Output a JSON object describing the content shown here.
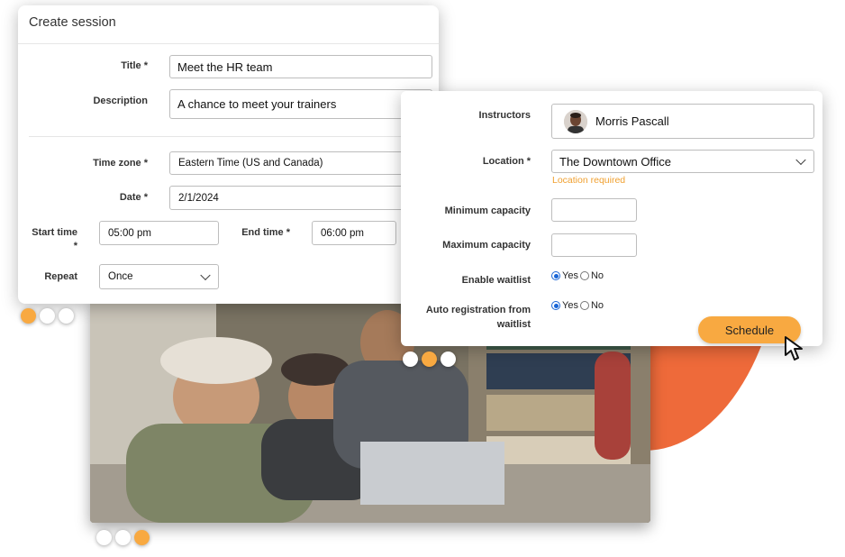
{
  "create_session": {
    "title": "Create session",
    "title_label": "Title *",
    "title_value": "Meet the HR team",
    "description_label": "Description",
    "description_value": "A chance to meet your trainers",
    "timezone_label": "Time zone *",
    "timezone_value": "Eastern Time (US and Canada)",
    "date_label": "Date *",
    "date_value": "2/1/2024",
    "start_time_label": "Start time",
    "start_time_star": "*",
    "start_time_value": "05:00 pm",
    "end_time_label": "End time *",
    "end_time_value": "06:00 pm",
    "repeat_label": "Repeat",
    "repeat_value": "Once"
  },
  "details": {
    "instructors_label": "Instructors",
    "instructor_name": "Morris Pascall",
    "location_label": "Location *",
    "location_value": "The Downtown Office",
    "location_error": "Location required",
    "min_capacity_label": "Minimum capacity",
    "min_capacity_value": "",
    "max_capacity_label": "Maximum capacity",
    "max_capacity_value": "",
    "waitlist_label": "Enable waitlist",
    "auto_reg_label_line1": "Auto registration from",
    "auto_reg_label_line2": "waitlist",
    "yes": "Yes",
    "no": "No",
    "schedule_button": "Schedule"
  },
  "carousel": {
    "left_card_active": 1,
    "right_card_active": 2,
    "photo_active": 3
  },
  "colors": {
    "accent": "#f8a941",
    "arc": "#ee6a3a",
    "warning": "#f0a030",
    "radio": "#1a66d6"
  }
}
